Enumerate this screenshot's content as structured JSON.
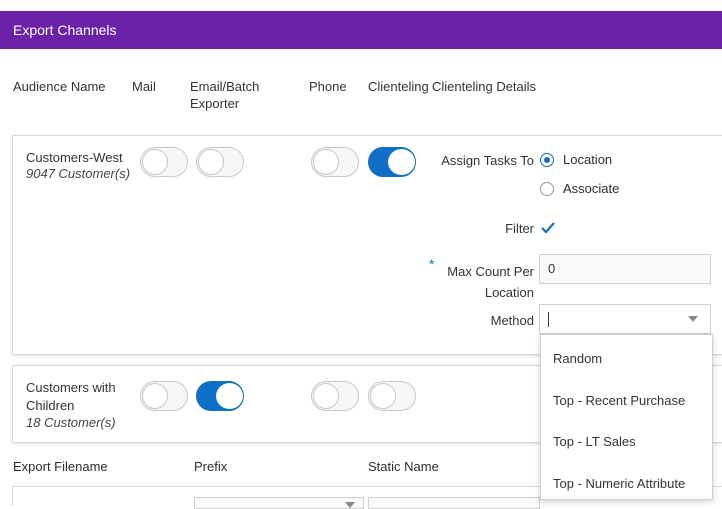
{
  "header": {
    "title": "Export Channels"
  },
  "columns": {
    "audience_name": "Audience Name",
    "mail": "Mail",
    "email_batch_l1": "Email/Batch",
    "email_batch_l2": "Exporter",
    "phone": "Phone",
    "clienteling": "Clienteling",
    "clienteling_details": "Clienteling Details"
  },
  "audiences": [
    {
      "name": "Customers-West",
      "count": "9047 Customer(s)",
      "mail": false,
      "email": false,
      "phone": false,
      "clienteling": true
    },
    {
      "name_l1": "Customers with",
      "name_l2": "Children",
      "count": "18 Customer(s)",
      "mail": false,
      "email": true,
      "phone": false,
      "clienteling": false
    }
  ],
  "details": {
    "assign_tasks_label": "Assign Tasks To",
    "options": [
      "Location",
      "Associate"
    ],
    "selected_option": "Location",
    "filter_label": "Filter",
    "filter_checked": true,
    "required_mark": "*",
    "max_count_label_l1": "Max Count Per",
    "max_count_label_l2": "Location",
    "max_count_value": "0",
    "method_label": "Method",
    "method_value": ""
  },
  "method_menu": [
    "Random",
    "Top - Recent Purchase",
    "Top - LT Sales",
    "Top - Numeric Attribute"
  ],
  "export": {
    "filename_label": "Export Filename",
    "prefix_label": "Prefix",
    "static_name_label": "Static Name"
  },
  "colors": {
    "header": "#6b21a8",
    "accent": "#0f6fc6"
  }
}
